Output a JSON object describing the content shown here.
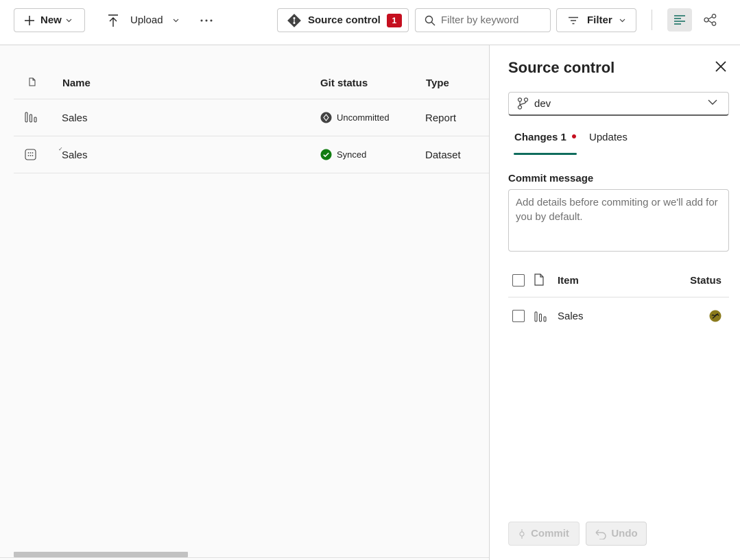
{
  "toolbar": {
    "new_label": "New",
    "upload_label": "Upload",
    "more_label": "···",
    "source_control_label": "Source control",
    "source_control_count": "1",
    "search_placeholder": "Filter by keyword",
    "filter_label": "Filter"
  },
  "table": {
    "headers": {
      "name": "Name",
      "git_status": "Git status",
      "type": "Type"
    },
    "rows": [
      {
        "name": "Sales",
        "git_status": "Uncommitted",
        "type": "Report",
        "icon": "report-icon",
        "status_icon": "uncommitted-icon"
      },
      {
        "name": "Sales",
        "git_status": "Synced",
        "type": "Dataset",
        "icon": "dataset-icon",
        "status_icon": "synced-check-icon"
      }
    ]
  },
  "panel": {
    "title": "Source control",
    "branch": "dev",
    "tabs": {
      "changes": "Changes 1",
      "updates": "Updates"
    },
    "commit_label": "Commit message",
    "commit_placeholder": "Add details before commiting or we'll add for you by default.",
    "items_header": {
      "item": "Item",
      "status": "Status"
    },
    "items": [
      {
        "name": "Sales",
        "icon": "report-icon",
        "status_icon": "modified-status-icon"
      }
    ],
    "commit_button": "Commit",
    "undo_button": "Undo"
  },
  "colors": {
    "accent": "#0f6c5d",
    "badge": "#c50f1f",
    "synced": "#107c10",
    "modified": "#8a7a1c"
  }
}
